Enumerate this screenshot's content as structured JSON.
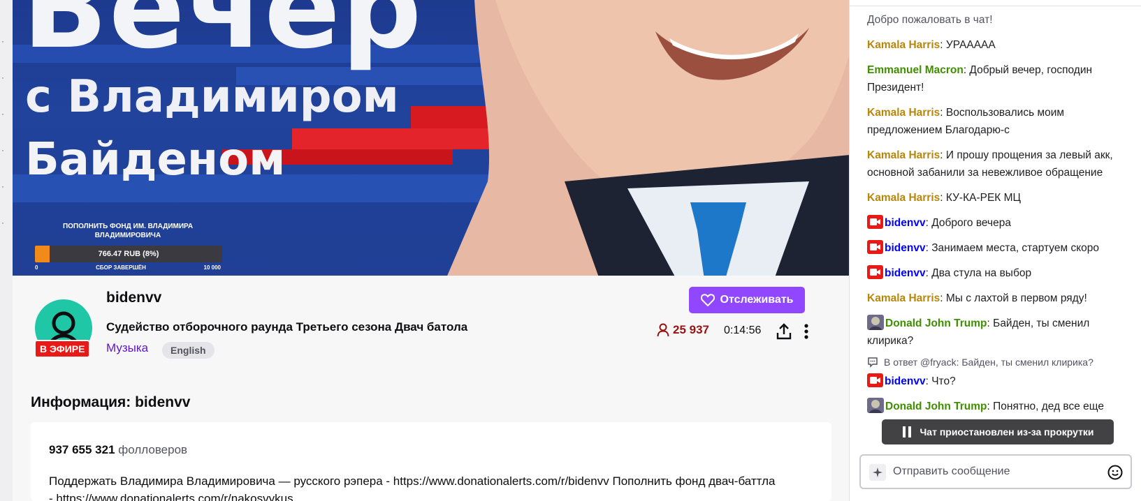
{
  "video": {
    "banner_title": "Вечер",
    "banner_line2": "с Владимиром",
    "banner_line3": "Байденом",
    "donation": {
      "title": "ПОПОЛНИТЬ ФОНД ИМ. ВЛАДИМИРА ВЛАДИМИРОВИЧА",
      "amount_label": "766.47 RUB (8%)",
      "progress_fraction": 0.08,
      "scale_min": "0",
      "scale_status": "СБОР ЗАВЕРШЁН",
      "scale_max": "10 000"
    }
  },
  "channel": {
    "name": "bidenvv",
    "live_badge": "В ЭФИРЕ",
    "stream_title": "Судейство отборочного раунда Третьего сезона Двач батола",
    "category": "Музыка",
    "tag": "English",
    "follow_label": "Отслеживать",
    "viewers": "25 937",
    "uptime": "0:14:56"
  },
  "about": {
    "title": "Информация: bidenvv",
    "followers_count": "937 655 321",
    "followers_label": "фолловеров",
    "description": "Поддержать Владимира Владимировича — русского рэпера - https://www.donationalerts.com/r/bidenvv Пополнить фонд двач-баттла - https://www.donationalerts.com/r/nakosvykus"
  },
  "chat": {
    "welcome": "Добро пожаловать в чат!",
    "messages": [
      {
        "user": "Kamala Harris",
        "color": "#b8860b",
        "text": ": УРААААА"
      },
      {
        "user": "Emmanuel Macron",
        "color": "#3f8f00",
        "text": ": Добрый вечер, господин Президент!"
      },
      {
        "user": "Kamala Harris",
        "color": "#b8860b",
        "text": ": Воспользовались моим предложением Благодарю-с"
      },
      {
        "user": "Kamala Harris",
        "color": "#b8860b",
        "text": ": И прошу прощения за левый акк, основной забанили за невежливое обращение"
      },
      {
        "user": "Kamala Harris",
        "color": "#b8860b",
        "text": ": КУ-КА-РЕК МЦ"
      },
      {
        "user": "bidenvv",
        "color": "#0000ff",
        "text": ": Доброго вечера"
      },
      {
        "user": "bidenvv",
        "color": "#0000ff",
        "text": ": Занимаем места, стартуем скоро"
      },
      {
        "user": "bidenvv",
        "color": "#0000ff",
        "text": ": Два стула на выбор"
      },
      {
        "user": "Kamala Harris",
        "color": "#b8860b",
        "text": ": Мы с лахтой в первом ряду!"
      },
      {
        "user": "Donald John Trump",
        "color": "#3f8f00",
        "text": ": Байден, ты сменил клирика?"
      },
      {
        "reply": "В ответ @fryack: Байден, ты сменил клирика?"
      },
      {
        "user": "bidenvv",
        "color": "#0000ff",
        "text": ": Что?"
      },
      {
        "user": "Donald John Trump",
        "color": "#3f8f00",
        "text": ": Понятно, дед все еще"
      }
    ],
    "paused_label": "Чат приостановлен из-за прокрутки",
    "input_placeholder": "Отправить сообщение"
  },
  "colors": {
    "accent": "#9147ff",
    "live": "#e91916",
    "viewers": "#971311"
  },
  "icons": [
    "heart-icon",
    "user-icon",
    "share-icon",
    "more-vertical-icon",
    "broadcaster-badge-icon",
    "reply-icon",
    "pause-icon",
    "bits-icon",
    "emote-icon"
  ]
}
